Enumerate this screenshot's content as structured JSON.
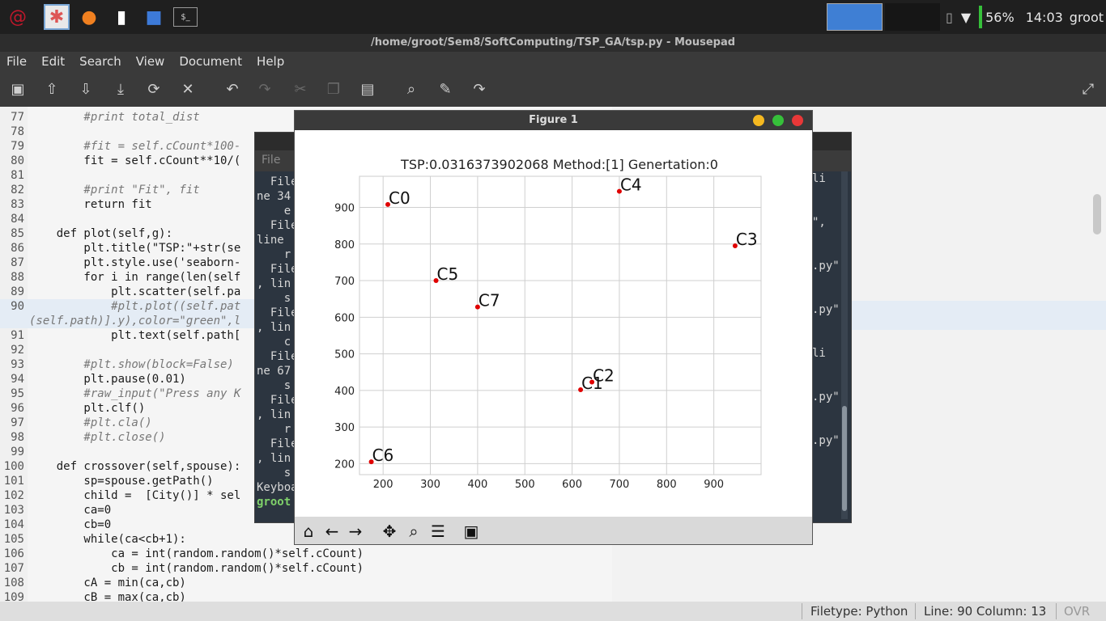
{
  "taskbar": {
    "battery": "56%",
    "time": "14:03",
    "user": "groot"
  },
  "window": {
    "title": "/home/groot/Sem8/SoftComputing/TSP_GA/tsp.py - Mousepad"
  },
  "menu": [
    "File",
    "Edit",
    "Search",
    "View",
    "Document",
    "Help"
  ],
  "code": [
    {
      "n": "77",
      "t": "        #print total_dist",
      "cls": "c"
    },
    {
      "n": "78",
      "t": ""
    },
    {
      "n": "79",
      "t": "        #fit = self.cCount*100-",
      "cls": "c"
    },
    {
      "n": "80",
      "t": "        fit = self.cCount**10/("
    },
    {
      "n": "81",
      "t": ""
    },
    {
      "n": "82",
      "t": "        #print \"Fit\", fit",
      "cls": "c"
    },
    {
      "n": "83",
      "t": "        return fit"
    },
    {
      "n": "84",
      "t": ""
    },
    {
      "n": "85",
      "t": "    def plot(self,g):"
    },
    {
      "n": "86",
      "t": "        plt.title(\"TSP:\"+str(se"
    },
    {
      "n": "87",
      "t": "        plt.style.use('seaborn-"
    },
    {
      "n": "88",
      "t": "        for i in range(len(self"
    },
    {
      "n": "89",
      "t": "            plt.scatter(self.pa"
    },
    {
      "n": "90",
      "t": "            #plt.plot((self.pat",
      "cls": "c"
    },
    {
      "n": "",
      "t": "(self.path)].y),color=\"green\",l",
      "cls": "c"
    },
    {
      "n": "91",
      "t": "            plt.text(self.path["
    },
    {
      "n": "92",
      "t": ""
    },
    {
      "n": "93",
      "t": "        #plt.show(block=False)",
      "cls": "c"
    },
    {
      "n": "94",
      "t": "        plt.pause(0.01)"
    },
    {
      "n": "95",
      "t": "        #raw_input(\"Press any K",
      "cls": "c"
    },
    {
      "n": "96",
      "t": "        plt.clf()"
    },
    {
      "n": "97",
      "t": "        #plt.cla()",
      "cls": "c"
    },
    {
      "n": "98",
      "t": "        #plt.close()",
      "cls": "c"
    },
    {
      "n": "99",
      "t": ""
    },
    {
      "n": "100",
      "t": "    def crossover(self,spouse):"
    },
    {
      "n": "101",
      "t": "        sp=spouse.getPath()"
    },
    {
      "n": "102",
      "t": "        child =  [City()] * sel"
    },
    {
      "n": "103",
      "t": "        ca=0"
    },
    {
      "n": "104",
      "t": "        cb=0"
    },
    {
      "n": "105",
      "t": "        while(ca<cb+1):"
    },
    {
      "n": "106",
      "t": "            ca = int(random.random()*self.cCount)"
    },
    {
      "n": "107",
      "t": "            cb = int(random.random()*self.cCount)"
    },
    {
      "n": "108",
      "t": "        cA = min(ca,cb)"
    },
    {
      "n": "109",
      "t": "        cB = max(ca,cb)"
    }
  ],
  "right_fragments": [
    "li",
    "\",",
    ".py\"",
    ".py\"",
    "li",
    ".py\"",
    ".py\""
  ],
  "terminal": {
    "menu": "File",
    "lines": [
      "  File",
      "ne 34",
      "    e",
      "  File",
      "line",
      "    r",
      "  File",
      ", lin",
      "    s",
      "  File",
      ", lin",
      "    c",
      "  File",
      "ne 67",
      "    s",
      "  File",
      ", lin",
      "    r",
      "  File",
      ", lin",
      "    s",
      "Keyboa",
      "groot"
    ]
  },
  "figure": {
    "window_title": "Figure 1"
  },
  "chart_data": {
    "type": "scatter",
    "title": "TSP:0.0316373902068  Method:[1]  Genertation:0",
    "xlim": [
      150,
      1000
    ],
    "ylim": [
      170,
      985
    ],
    "xticks": [
      200,
      300,
      400,
      500,
      600,
      700,
      800,
      900
    ],
    "yticks": [
      200,
      300,
      400,
      500,
      600,
      700,
      800,
      900
    ],
    "grid": true,
    "points": [
      {
        "label": "C0",
        "x": 210,
        "y": 908
      },
      {
        "label": "C1",
        "x": 618,
        "y": 402
      },
      {
        "label": "C2",
        "x": 642,
        "y": 423
      },
      {
        "label": "C3",
        "x": 945,
        "y": 795
      },
      {
        "label": "C4",
        "x": 700,
        "y": 944
      },
      {
        "label": "C5",
        "x": 312,
        "y": 700
      },
      {
        "label": "C6",
        "x": 175,
        "y": 205
      },
      {
        "label": "C7",
        "x": 400,
        "y": 628
      }
    ],
    "point_color": "#e00000"
  },
  "status": {
    "filetype": "Filetype: Python",
    "position": "Line: 90 Column: 13",
    "mode": "OVR"
  }
}
